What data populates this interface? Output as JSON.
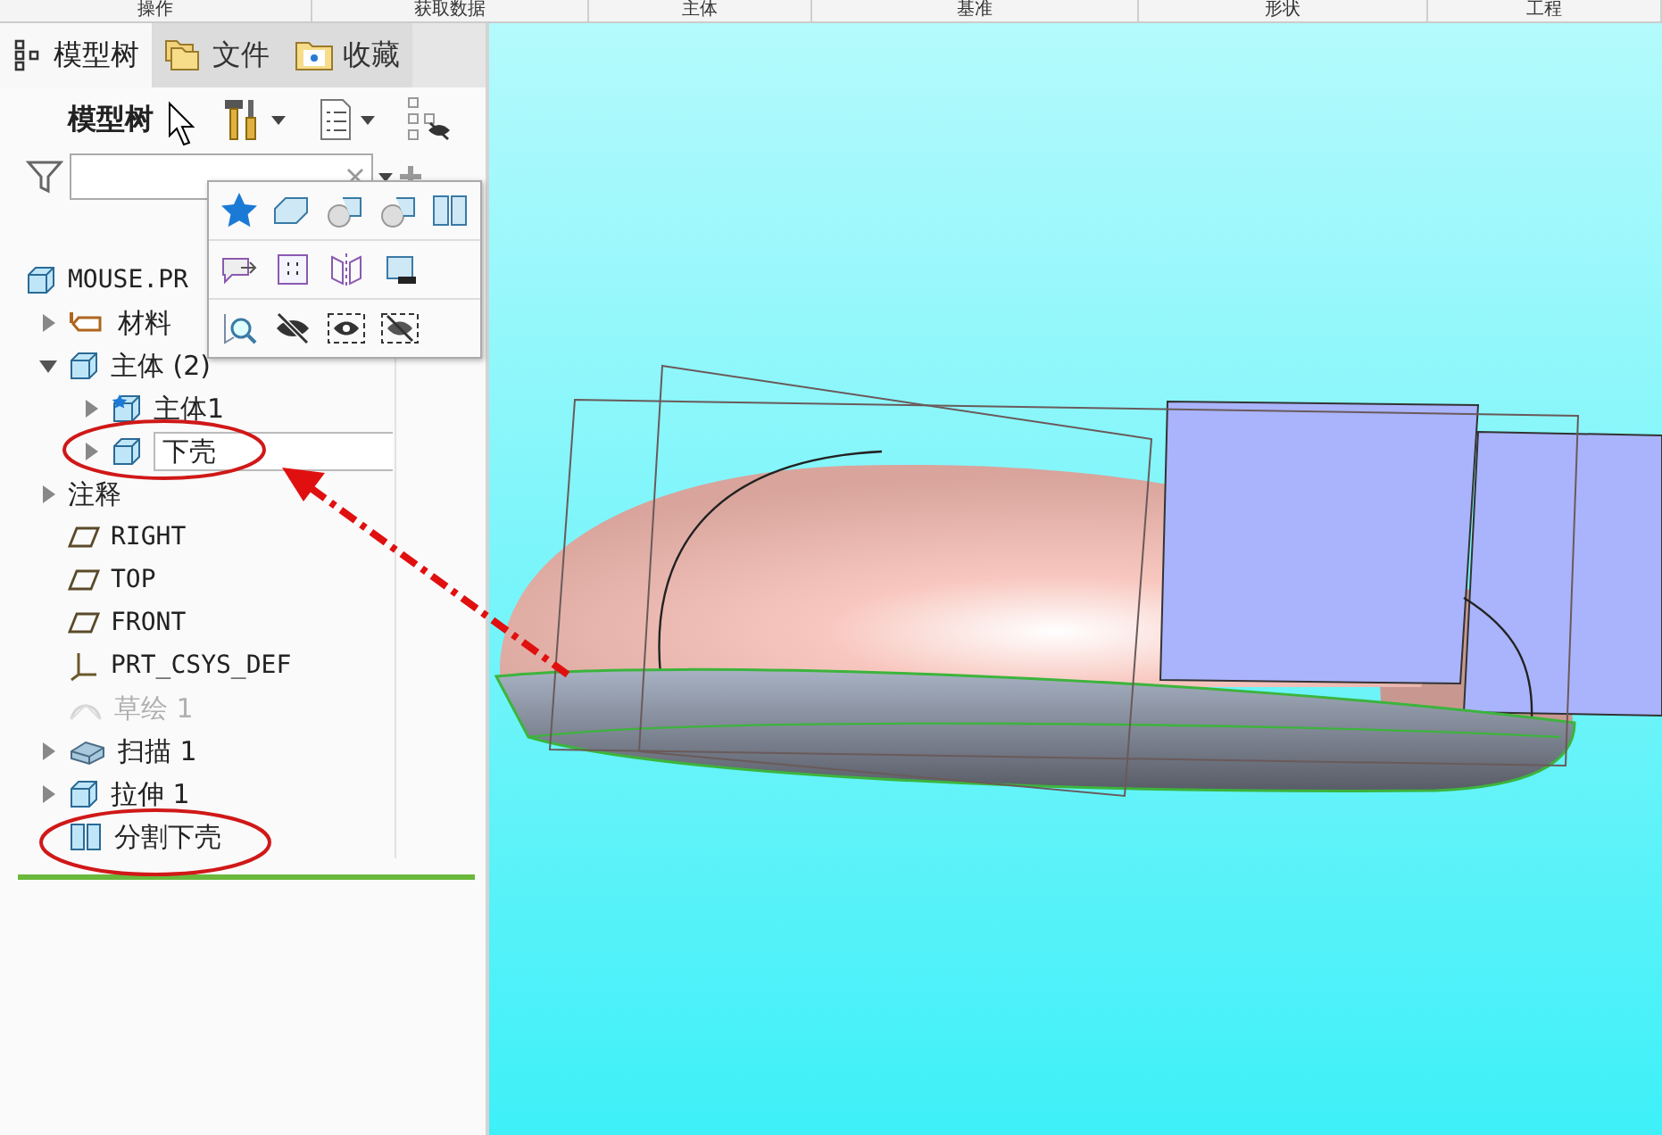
{
  "ribbon": {
    "groups": [
      "操作",
      "获取数据",
      "主体",
      "基准",
      "形状",
      "工程"
    ]
  },
  "panel_tabs": [
    {
      "label": "模型树",
      "selected": true,
      "kind": "tree"
    },
    {
      "label": "文件",
      "selected": false,
      "kind": "folder"
    },
    {
      "label": "收藏",
      "selected": false,
      "kind": "favorites"
    }
  ],
  "panel_title": "模型树",
  "tree": {
    "label": "MOUSE.PR",
    "kind": "part",
    "children": [
      {
        "label": "材料",
        "kind": "material",
        "expanded": false,
        "disabled": false
      },
      {
        "label": "主体 (2)",
        "kind": "body",
        "expanded": true,
        "disabled": false,
        "children": [
          {
            "label": "主体1",
            "kind": "body-star",
            "expanded": false,
            "disabled": false
          },
          {
            "label": "下壳",
            "kind": "body",
            "expanded": false,
            "disabled": false,
            "editing": true
          }
        ]
      },
      {
        "label": "注释",
        "kind": "annotation",
        "expanded": false,
        "disabled": false
      },
      {
        "label": "RIGHT",
        "kind": "plane",
        "disabled": false
      },
      {
        "label": "TOP",
        "kind": "plane",
        "disabled": false
      },
      {
        "label": "FRONT",
        "kind": "plane",
        "disabled": false
      },
      {
        "label": "PRT_CSYS_DEF",
        "kind": "csys",
        "disabled": false
      },
      {
        "label": "草绘 1",
        "kind": "sketch",
        "disabled": true
      },
      {
        "label": "扫描 1",
        "kind": "sweep",
        "expanded": false,
        "disabled": false
      },
      {
        "label": "拉伸 1",
        "kind": "extrude",
        "expanded": false,
        "disabled": false
      },
      {
        "label": "分割下壳",
        "kind": "split",
        "disabled": false
      }
    ]
  }
}
